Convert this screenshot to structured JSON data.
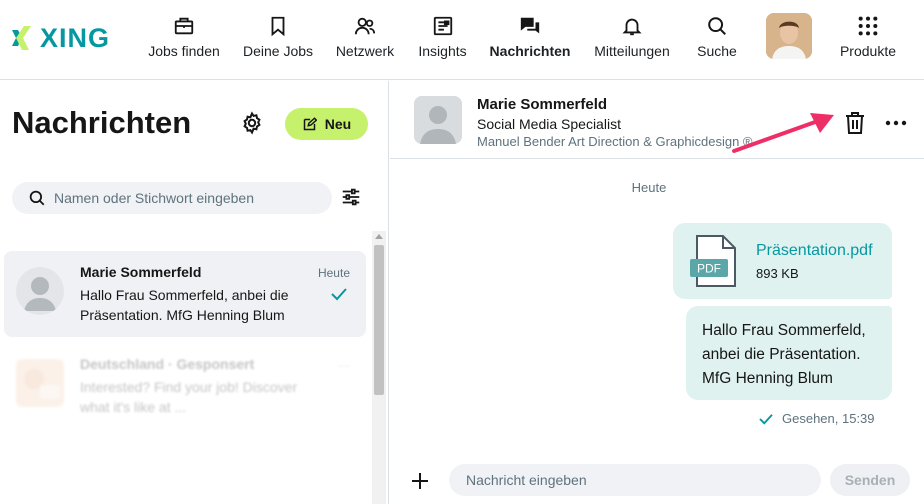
{
  "brand": {
    "name": "XING",
    "accent": "#0698a0",
    "green": "#c6f16d",
    "bubble": "#dff2f0"
  },
  "nav": {
    "items": [
      {
        "label": "Jobs finden",
        "icon": "briefcase-icon"
      },
      {
        "label": "Deine Jobs",
        "icon": "bookmark-icon"
      },
      {
        "label": "Netzwerk",
        "icon": "network-icon"
      },
      {
        "label": "Insights",
        "icon": "insights-icon"
      },
      {
        "label": "Nachrichten",
        "icon": "messages-icon",
        "active": true
      },
      {
        "label": "Mitteilungen",
        "icon": "bell-icon"
      },
      {
        "label": "Suche",
        "icon": "search-icon"
      },
      {
        "label": "Produkte",
        "icon": "grid-icon"
      }
    ]
  },
  "sidebar": {
    "title": "Nachrichten",
    "new_label": "Neu",
    "search_placeholder": "Namen oder Stichwort eingeben",
    "conversations": [
      {
        "name": "Marie Sommerfeld",
        "time": "Heute",
        "preview": "Hallo Frau Sommerfeld, anbei die Präsentation. MfG Henning Blum",
        "read": true
      },
      {
        "name": "Deutschland · Gesponsert",
        "time": "···",
        "preview": "Interested? Find your job! Discover what it's like at ..."
      }
    ]
  },
  "chat": {
    "name": "Marie Sommerfeld",
    "role": "Social Media Specialist",
    "company": "Manuel Bender Art Direction & Graphicdesign ®",
    "day": "Heute",
    "file": {
      "name": "Präsentation.pdf",
      "size": "893 KB",
      "type": "PDF"
    },
    "message": "Hallo Frau Sommerfeld, anbei die Präsentation. MfG Henning Blum",
    "seen": "Gesehen, 15:39",
    "input_placeholder": "Nachricht eingeben",
    "send_label": "Senden"
  }
}
